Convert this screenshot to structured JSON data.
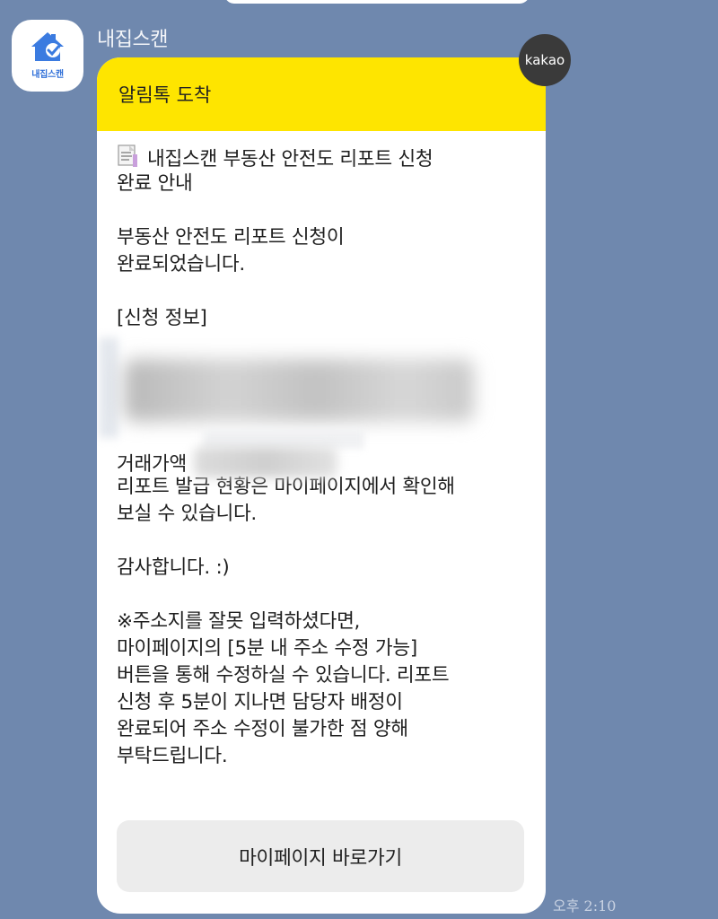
{
  "sender": {
    "name": "내집스캔",
    "avatar_label": "내집스캔"
  },
  "badge": {
    "label": "kakao"
  },
  "message": {
    "header": "알림톡 도착",
    "lines_top": [
      "내집스캔 부동산 안전도 리포트 신청",
      "완료 안내",
      "",
      "부동산 안전도 리포트 신청이",
      "완료되었습니다.",
      "",
      "[신청 정보]"
    ],
    "price_label": "거래가액",
    "lines_bottom": [
      "리포트 발급 현황은 마이페이지에서 확인해",
      "보실 수 있습니다.",
      "",
      "감사합니다. :)",
      "",
      "※주소지를 잘못 입력하셨다면,",
      "마이페이지의 [5분 내 주소 수정 가능]",
      "버튼을 통해 수정하실 수 있습니다. 리포트",
      "신청 후 5분이 지나면 담당자 배정이",
      "완료되어 주소 수정이 불가한 점 양해",
      "부탁드립니다."
    ],
    "button_label": "마이페이지 바로가기"
  },
  "timestamp": "오후 2:10",
  "icons": {
    "doc": "document-icon",
    "avatar": "house-check-logo"
  }
}
